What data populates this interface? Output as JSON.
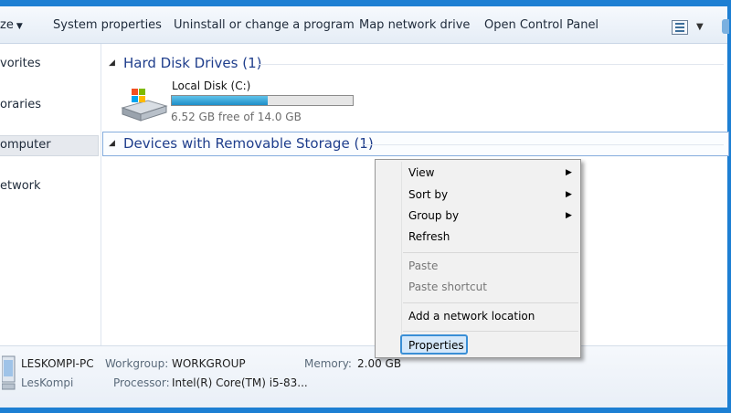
{
  "toolbar": {
    "organize_label": "ze",
    "system_properties": "System properties",
    "uninstall": "Uninstall or change a program",
    "map_drive": "Map network drive",
    "control_panel": "Open Control Panel"
  },
  "nav": {
    "favorites": "vorites",
    "libraries": "oraries",
    "computer": "omputer",
    "network": "etwork"
  },
  "groups": {
    "hdd_header": "Hard Disk Drives (1)",
    "removable_header": "Devices with Removable Storage (1)"
  },
  "drive": {
    "name": "Local Disk (C:)",
    "free_text": "6.52 GB free of 14.0 GB",
    "used_fraction": 0.53
  },
  "context_menu": {
    "view": "View",
    "sort_by": "Sort by",
    "group_by": "Group by",
    "refresh": "Refresh",
    "paste": "Paste",
    "paste_shortcut": "Paste shortcut",
    "add_network_location": "Add a network location",
    "properties": "Properties"
  },
  "details": {
    "pc_name": "LESKOMPI-PC",
    "user": "LesKompi",
    "workgroup_label": "Workgroup:",
    "workgroup_value": "WORKGROUP",
    "processor_label": "Processor:",
    "processor_value": "Intel(R) Core(TM) i5-83...",
    "memory_label": "Memory:",
    "memory_value": "2.00 GB"
  },
  "icons": [
    "caret-down-icon",
    "view-options-icon",
    "hard-drive-icon",
    "submenu-arrow-icon",
    "computer-icon"
  ],
  "colors": {
    "frame": "#1d7fd3",
    "group_header": "#1f3e8c",
    "drive_fill": "#1e8ec8",
    "selection_border": "#3a8fd6"
  }
}
